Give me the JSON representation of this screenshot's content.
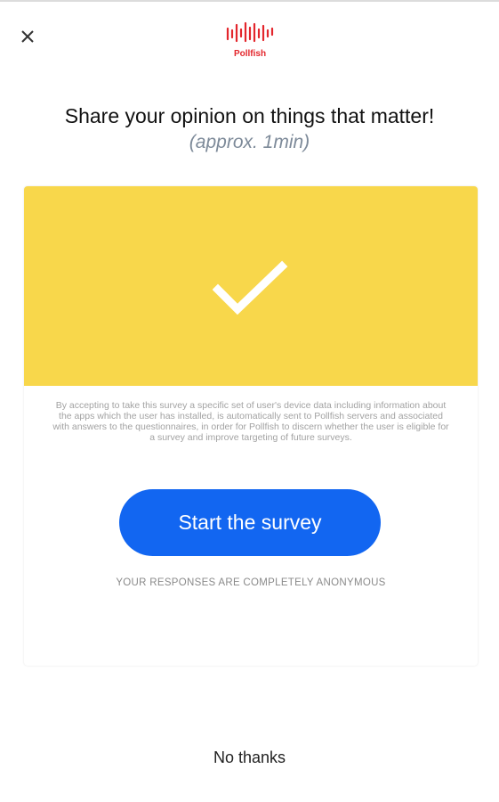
{
  "header": {
    "close_icon": "close-icon",
    "logo_text": "Pollfish",
    "brand_color": "#e3262c"
  },
  "intro": {
    "headline": "Share your opinion on things that matter!",
    "duration": "(approx. 1min)"
  },
  "card": {
    "banner_color": "#f8d74b",
    "banner_icon": "checkmark-icon",
    "disclaimer": "By accepting to take this survey a specific set of user's device data including information about the apps which the user has installed, is automatically sent to Pollfish servers and associated with answers to the questionnaires, in order for Pollfish to discern whether the user is eligible for a survey and improve targeting of future surveys.",
    "start_button_label": "Start the survey",
    "start_button_color": "#1266f1",
    "anonymous_note": "YOUR RESPONSES ARE COMPLETELY ANONYMOUS"
  },
  "footer": {
    "no_thanks_label": "No thanks"
  }
}
